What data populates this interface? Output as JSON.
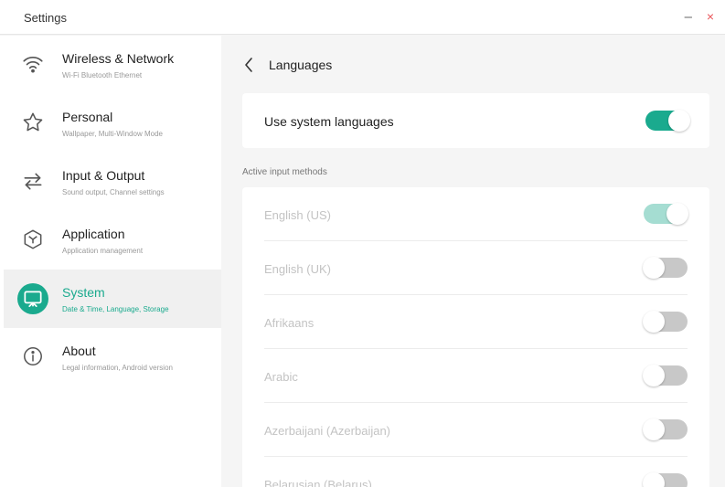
{
  "window": {
    "title": "Settings",
    "minimize_glyph": "–",
    "close_glyph": "×"
  },
  "colors": {
    "accent": "#1aaa8e",
    "close": "#e9555a"
  },
  "sidebar": {
    "items": [
      {
        "label": "Wireless & Network",
        "sub": "Wi-Fi Bluetooth Ethernet",
        "icon": "wifi-icon",
        "active": false
      },
      {
        "label": "Personal",
        "sub": "Wallpaper, Multi-Window Mode",
        "icon": "star-icon",
        "active": false
      },
      {
        "label": "Input & Output",
        "sub": "Sound output, Channel settings",
        "icon": "swap-arrows-icon",
        "active": false
      },
      {
        "label": "Application",
        "sub": "Application management",
        "icon": "cube-icon",
        "active": false
      },
      {
        "label": "System",
        "sub": "Date & Time, Language, Storage",
        "icon": "monitor-icon",
        "active": true
      },
      {
        "label": "About",
        "sub": "Legal information, Android version",
        "icon": "info-icon",
        "active": false
      }
    ]
  },
  "main": {
    "title": "Languages",
    "system_languages": {
      "label": "Use system languages",
      "enabled": true
    },
    "section_label": "Active input methods",
    "methods": [
      {
        "label": "English (US)",
        "enabled": true
      },
      {
        "label": "English (UK)",
        "enabled": false
      },
      {
        "label": "Afrikaans",
        "enabled": false
      },
      {
        "label": "Arabic",
        "enabled": false
      },
      {
        "label": "Azerbaijani (Azerbaijan)",
        "enabled": false
      },
      {
        "label": "Belarusian (Belarus)",
        "enabled": false
      }
    ]
  }
}
